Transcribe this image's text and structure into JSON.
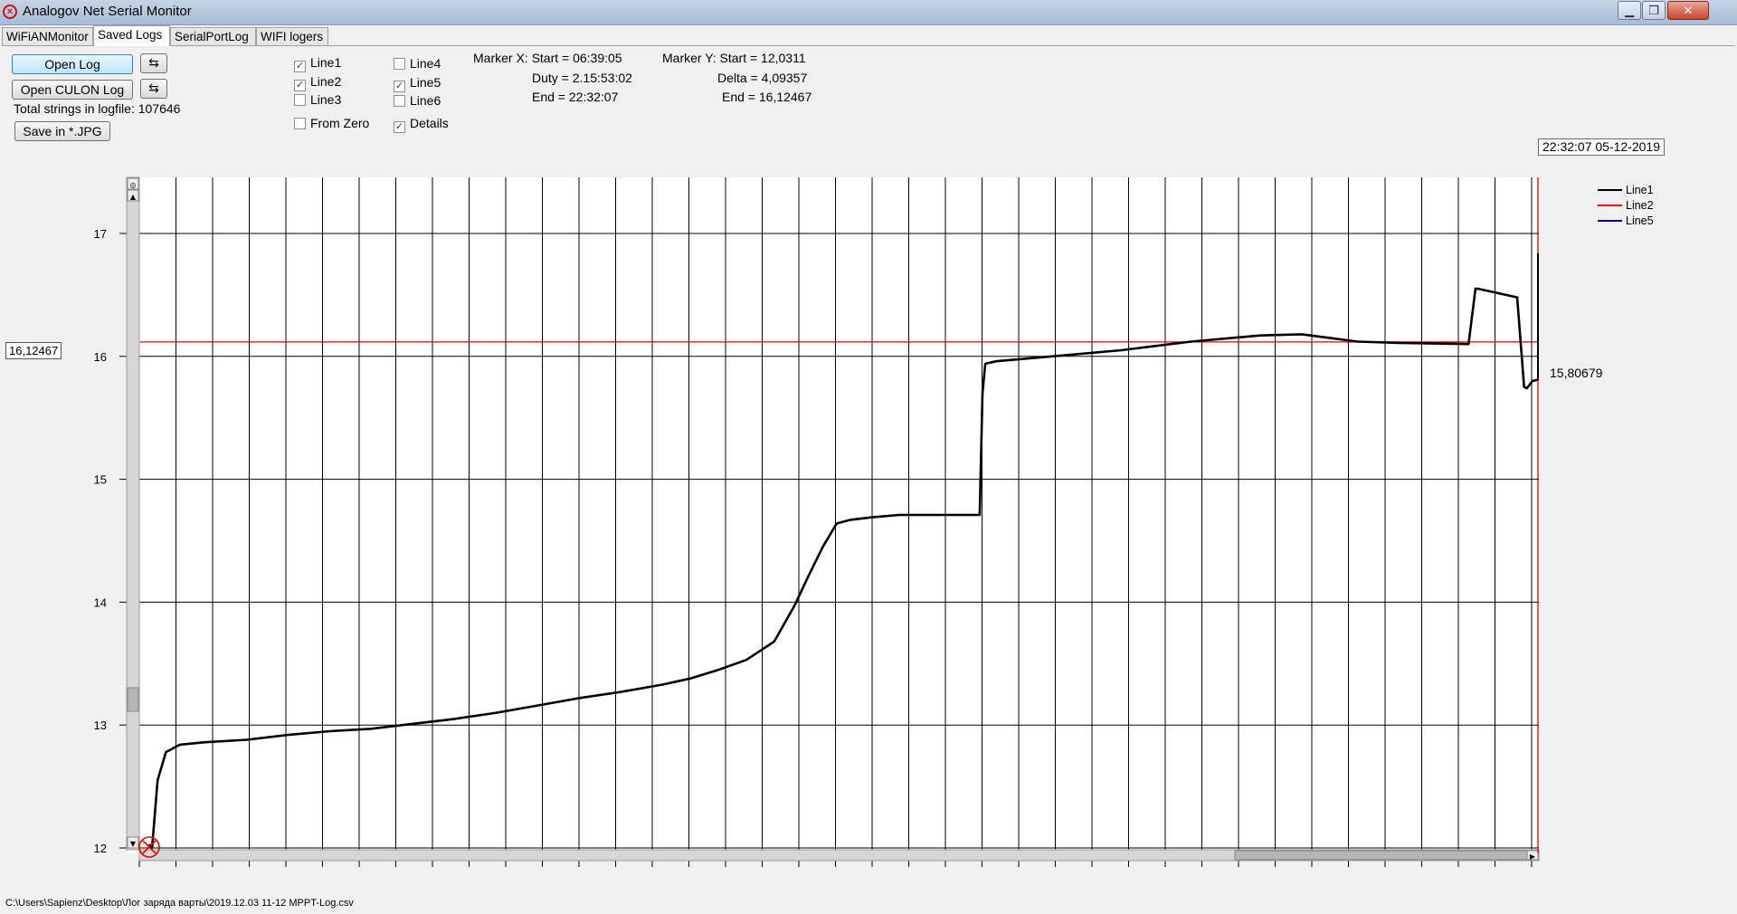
{
  "window": {
    "title": "Analogov Net Serial Monitor",
    "minimize_glyph": "▁",
    "maximize_glyph": "❐",
    "close_glyph": "✕"
  },
  "tabs": [
    {
      "label": "WiFiANMonitor",
      "active": false
    },
    {
      "label": "Saved Logs",
      "active": true
    },
    {
      "label": "SerialPortLog",
      "active": false
    },
    {
      "label": "WIFI logers",
      "active": false
    }
  ],
  "controls": {
    "open_log": "Open Log",
    "open_culon_log": "Open CULON Log",
    "refresh_glyph": "⇆",
    "total_strings_label": "Total strings in logfile: 107646",
    "save_jpg": "Save in *.JPG"
  },
  "checkboxes": [
    {
      "label": "Line1",
      "checked": true
    },
    {
      "label": "Line2",
      "checked": true
    },
    {
      "label": "Line3",
      "checked": false
    },
    {
      "label": "Line4",
      "checked": false
    },
    {
      "label": "Line5",
      "checked": true
    },
    {
      "label": "Line6",
      "checked": false
    },
    {
      "label": "From Zero",
      "checked": false
    },
    {
      "label": "Details",
      "checked": true
    }
  ],
  "marker_x": {
    "start": "Marker X: Start = 06:39:05",
    "duty": "Duty = 2.15:53:02",
    "end": "End  = 22:32:07"
  },
  "marker_y": {
    "start": "Marker Y: Start = 12,0311",
    "delta": "Delta = 4,09357",
    "end": "End  = 16,12467"
  },
  "cursor_datetime": "22:32:07 05-12-2019",
  "cursor_value": "16,12467",
  "end_value": "15,80679",
  "status_path": "C:\\Users\\Sapienz\\Desktop\\Лог заряда варты\\2019.12.03 11-12 MPPT-Log.csv",
  "colors": {
    "line1": "#000000",
    "line2": "#e00000",
    "line5": "#000080",
    "grid": "#000000",
    "marker": "#e00000"
  },
  "chart_data": {
    "type": "line",
    "title": "",
    "xlabel": "",
    "ylabel": "",
    "ylim": [
      12,
      17.5
    ],
    "yticks": [
      "17",
      "16",
      "15",
      "14",
      "13",
      "12"
    ],
    "legend": [
      "Line1",
      "Line2",
      "Line5"
    ],
    "legend_position": "top-right",
    "grid": true,
    "x_range": [
      "06:39:05",
      "22:32:07"
    ],
    "marker_y_value": 16.12467,
    "series": [
      {
        "name": "Line1",
        "x_fraction": [
          0.0,
          0.002,
          0.006,
          0.012,
          0.022,
          0.04,
          0.07,
          0.1,
          0.13,
          0.16,
          0.19,
          0.22,
          0.25,
          0.28,
          0.31,
          0.34,
          0.37,
          0.39,
          0.41,
          0.43,
          0.45,
          0.465,
          0.475,
          0.485,
          0.495,
          0.505,
          0.52,
          0.54,
          0.57,
          0.59,
          0.598,
          0.6,
          0.602,
          0.61,
          0.65,
          0.7,
          0.75,
          0.8,
          0.83,
          0.85,
          0.87,
          0.9,
          0.95,
          0.955,
          0.957,
          0.985,
          0.99,
          0.992,
          0.996,
          1.0
        ],
        "values": [
          12.03,
          12.0,
          12.55,
          12.78,
          12.84,
          12.86,
          12.88,
          12.92,
          12.95,
          12.97,
          13.01,
          13.05,
          13.1,
          13.16,
          13.22,
          13.27,
          13.33,
          13.38,
          13.45,
          13.53,
          13.68,
          13.98,
          14.22,
          14.45,
          14.64,
          14.67,
          14.69,
          14.71,
          14.71,
          14.71,
          14.71,
          15.7,
          15.94,
          15.96,
          16.0,
          16.05,
          16.12,
          16.17,
          16.18,
          16.15,
          16.12,
          16.11,
          16.1,
          16.55,
          16.55,
          16.48,
          15.75,
          15.74,
          15.8,
          15.81
        ]
      }
    ]
  }
}
